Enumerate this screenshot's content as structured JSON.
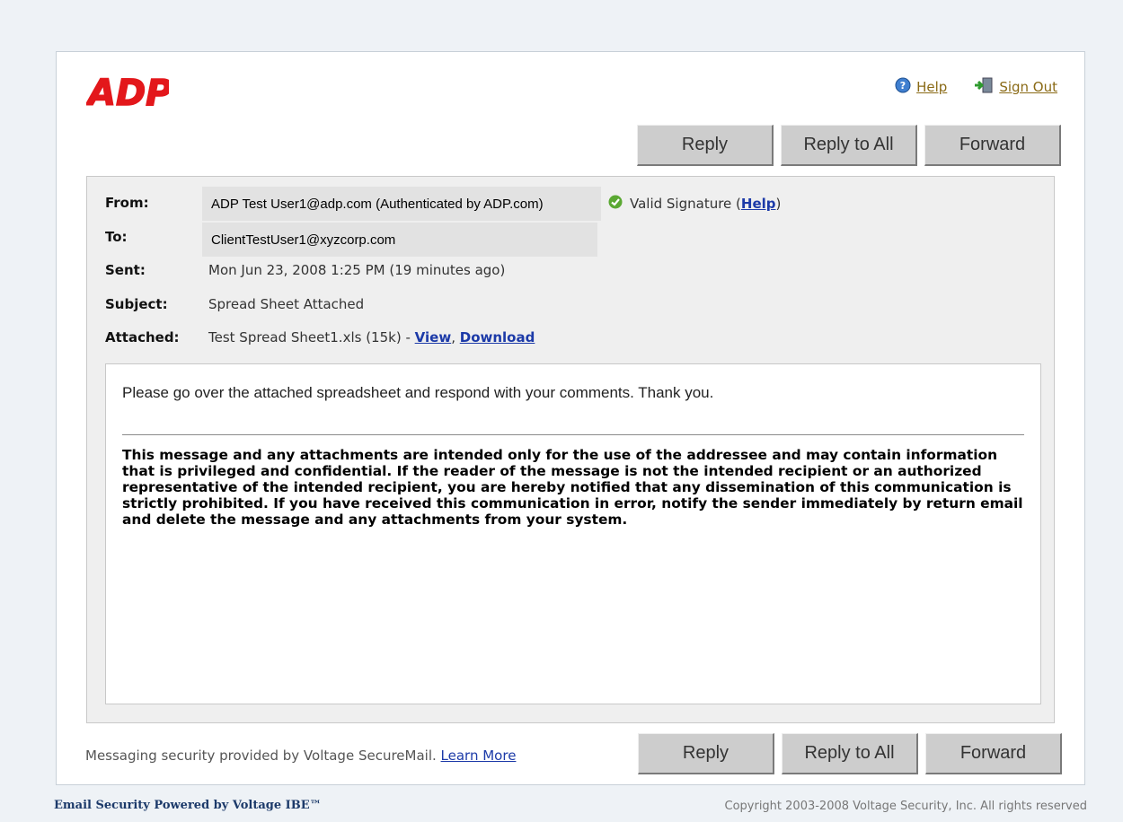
{
  "brand": {
    "logo_text": "ADP"
  },
  "top_links": {
    "help": "Help",
    "sign_out": "Sign Out"
  },
  "buttons": {
    "reply": "Reply",
    "reply_all": "Reply to All",
    "forward": "Forward"
  },
  "header": {
    "from_label": "From:",
    "from_value": "ADP Test User1@adp.com (Authenticated by ADP.com)",
    "signature_text": "Valid Signature",
    "signature_help": "Help",
    "to_label": "To:",
    "to_value": "ClientTestUser1@xyzcorp.com",
    "sent_label": "Sent:",
    "sent_value": "Mon Jun 23, 2008 1:25 PM (19 minutes ago)",
    "subject_label": "Subject:",
    "subject_value": "Spread Sheet Attached",
    "attached_label": "Attached:",
    "attached_file": "Test Spread Sheet1.xls (15k) -",
    "view_link": "View",
    "download_link": "Download"
  },
  "message": {
    "text": "Please go over the attached spreadsheet and respond with your comments.  Thank you.",
    "disclaimer": "This message and any attachments are intended only for the use of the addressee and may contain information that is privileged and confidential. If the reader of the message is not the intended recipient or an authorized representative of the intended recipient, you are hereby notified that any dissemination of this communication is strictly prohibited. If you have received this communication in error, notify the sender immediately by return email and delete the message and any attachments from your system."
  },
  "footer": {
    "security_note": "Messaging security provided by Voltage SecureMail.",
    "learn_more": "Learn More",
    "powered_by": "Email Security Powered by Voltage IBE™",
    "copyright": "Copyright 2003-2008 Voltage Security, Inc. All rights reserved"
  },
  "colors": {
    "brand_red": "#e3171b",
    "link_blue": "#1c3aa8",
    "link_gold": "#8a6a16",
    "button_gray": "#cdcdcd"
  }
}
